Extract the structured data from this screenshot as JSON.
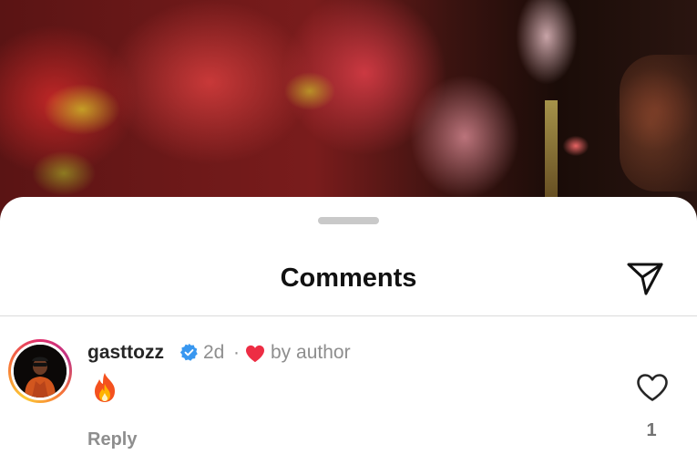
{
  "sheet": {
    "title": "Comments",
    "share_icon": "paper-plane-icon"
  },
  "comment": {
    "username": "gasttozz",
    "verified": true,
    "time": "2d",
    "separator": "·",
    "liked_by_author_icon": "heart-filled-icon",
    "liked_by_author_label": "by author",
    "text": "🔥",
    "reply_label": "Reply",
    "like_icon": "heart-outline-icon",
    "like_count": "1"
  },
  "colors": {
    "verified_badge": "#3897f0",
    "author_heart": "#ed2d44",
    "muted_text": "#8e8e8e",
    "username_text": "#262626",
    "drag_handle": "#c9c9c9",
    "divider": "#dbdbdb"
  }
}
